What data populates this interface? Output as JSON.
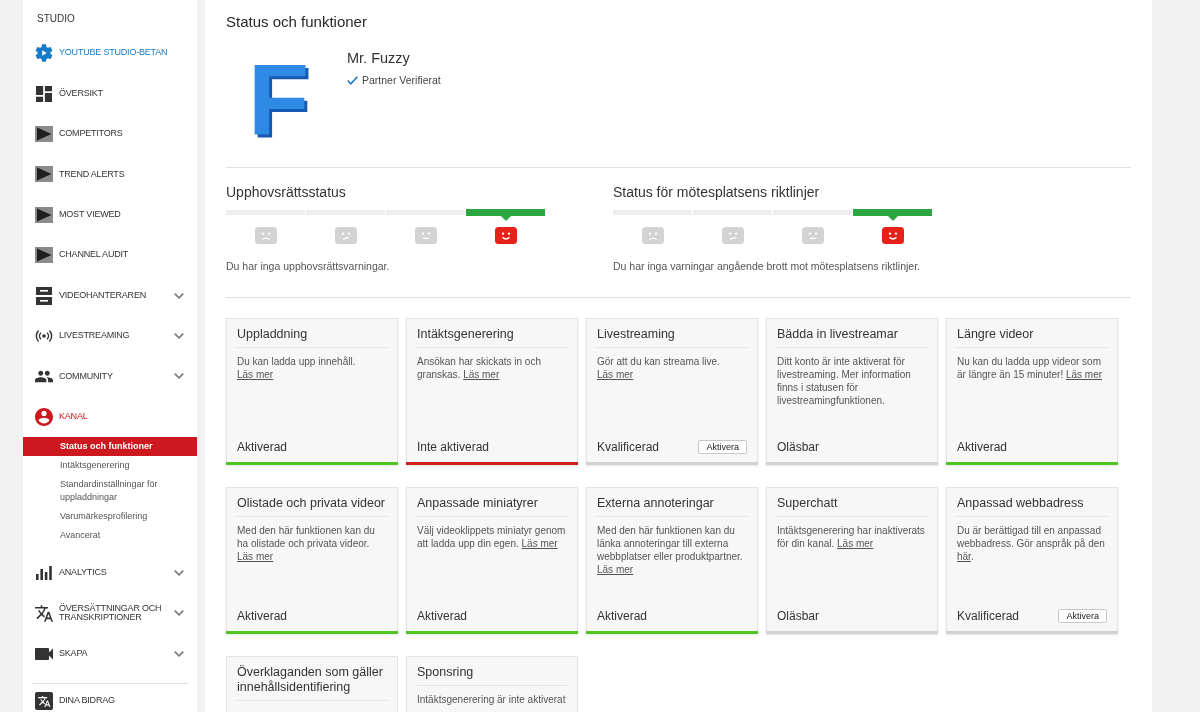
{
  "sidebar": {
    "heading": "STUDIO",
    "items": [
      {
        "label": "YOUTUBE STUDIO-BETAN",
        "kind": "promo",
        "selected": false
      },
      {
        "label": "ÖVERSIKT",
        "kind": "link",
        "selected": false
      },
      {
        "label": "COMPETITORS",
        "kind": "plugin",
        "selected": false
      },
      {
        "label": "TREND ALERTS",
        "kind": "plugin",
        "selected": false
      },
      {
        "label": "MOST VIEWED",
        "kind": "plugin",
        "selected": false
      },
      {
        "label": "CHANNEL AUDIT",
        "kind": "plugin",
        "selected": false
      },
      {
        "label": "VIDEOHANTERAREN",
        "kind": "menu",
        "selected": false,
        "expanded": false
      },
      {
        "label": "LIVESTREAMING",
        "kind": "menu",
        "selected": false,
        "expanded": false
      },
      {
        "label": "COMMUNITY",
        "kind": "menu",
        "selected": false,
        "expanded": false
      },
      {
        "label": "KANAL",
        "kind": "menu",
        "selected": true,
        "expanded": true,
        "children": [
          {
            "label": "Status och funktioner",
            "selected": true
          },
          {
            "label": "Intäktsgenerering",
            "selected": false
          },
          {
            "label": "Standardinställningar för uppladdningar",
            "selected": false
          },
          {
            "label": "Varumärkesprofilering",
            "selected": false
          },
          {
            "label": "Avancerat",
            "selected": false
          }
        ]
      },
      {
        "label": "ANALYTICS",
        "kind": "menu",
        "selected": false,
        "expanded": false
      },
      {
        "label": "ÖVERSÄTTNINGAR OCH TRANSKRIPTIONER",
        "kind": "menu",
        "selected": false,
        "expanded": false
      },
      {
        "label": "SKAPA",
        "kind": "menu",
        "selected": false,
        "expanded": false
      }
    ],
    "footer_items": [
      {
        "label": "DINA BIDRAG",
        "selected": false
      }
    ]
  },
  "main": {
    "title": "Status och funktioner",
    "channel": {
      "logo_text": "F",
      "name": "Mr. Fuzzy",
      "badge": "Partner Verifierat"
    },
    "status_sections": [
      {
        "title": "Upphovsrättsstatus",
        "steps": [
          {
            "selected": false
          },
          {
            "selected": false
          },
          {
            "selected": false
          },
          {
            "selected": true
          }
        ],
        "message": "Du har inga upphovsrättsvarningar."
      },
      {
        "title": "Status för mötesplatsens riktlinjer",
        "steps": [
          {
            "selected": false
          },
          {
            "selected": false
          },
          {
            "selected": false
          },
          {
            "selected": true
          }
        ],
        "message": "Du har inga varningar angående brott mot mötesplatsens riktlinjer."
      }
    ],
    "features": [
      {
        "title": "Uppladdning",
        "description": "Du kan ladda upp innehåll.",
        "link": "Läs mer",
        "status": "Aktiverad",
        "color": "#4cc71f"
      },
      {
        "title": "Intäktsgenerering",
        "description": "Ansökan har skickats in och granskas.",
        "link": "Läs mer",
        "status": "Inte aktiverad",
        "color": "#cc1f1f"
      },
      {
        "title": "Livestreaming",
        "description": "Gör att du kan streama live.",
        "link": "Läs mer",
        "status": "Kvalificerad",
        "button": "Aktivera",
        "color": "#d2d2d2"
      },
      {
        "title": "Bädda in livestreamar",
        "description": "Ditt konto är inte aktiverat för livestreaming. Mer information finns i statusen för livestreamingfunktionen.",
        "status": "Oläsbar",
        "color": "#d2d2d2"
      },
      {
        "title": "Längre videor",
        "description": "Nu kan du ladda upp videor som är längre än 15 minuter!",
        "link": "Läs mer",
        "status": "Aktiverad",
        "color": "#4cc71f"
      },
      {
        "title": "Olistade och privata videor",
        "description": "Med den här funktionen kan du ha olistade och privata videor.",
        "link": "Läs mer",
        "status": "Aktiverad",
        "color": "#4cc71f"
      },
      {
        "title": "Anpassade miniatyrer",
        "description": "Välj videoklippets miniatyr genom att ladda upp din egen.",
        "link": "Läs mer",
        "status": "Aktiverad",
        "color": "#4cc71f"
      },
      {
        "title": "Externa annoteringar",
        "description": "Med den här funktionen kan du länka annoteringar till externa webbplatser eller produktpartner.",
        "link": "Läs mer",
        "status": "Aktiverad",
        "color": "#4cc71f"
      },
      {
        "title": "Superchatt",
        "description": "Intäktsgenerering har inaktiverats för din kanal.",
        "link": "Läs mer",
        "status": "Oläsbar",
        "color": "#d2d2d2"
      },
      {
        "title": "Anpassad webbadress",
        "description": "Du är berättigad till en anpassad webbadress. Gör anspråk på den",
        "link": "här",
        "after_link": ".",
        "status": "Kvalificerad",
        "button": "Aktivera",
        "color": "#d2d2d2"
      },
      {
        "title": "Överklaganden som gäller innehållsidentifiering"
      },
      {
        "title": "Sponsring",
        "description": "Intäktsgenerering är inte aktiverat"
      }
    ]
  }
}
